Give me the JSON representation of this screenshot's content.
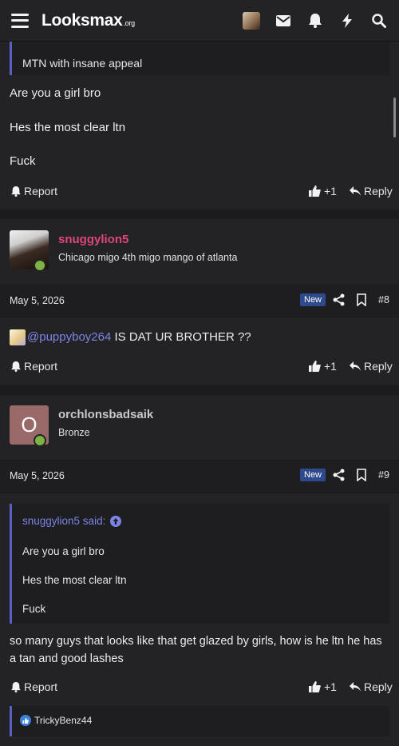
{
  "header": {
    "logo_main": "Looksmax",
    "logo_suffix": ".org"
  },
  "post1": {
    "quote_line": "MTN with insane appeal",
    "lines": [
      "Are you a girl bro",
      "Hes the most clear ltn",
      "Fuck"
    ],
    "report_label": "Report",
    "like_label": "+1",
    "reply_label": "Reply"
  },
  "post2": {
    "username": "snuggylion5",
    "user_title": "Chicago migo 4th migo mango of atlanta",
    "date": "May 5, 2026",
    "new_badge": "New",
    "post_number": "#8",
    "mention": "@puppyboy264",
    "text": " IS DAT UR BROTHER ??",
    "report_label": "Report",
    "like_label": "+1",
    "reply_label": "Reply",
    "username_color": "#e0457b"
  },
  "post3": {
    "avatar_letter": "O",
    "username": "orchlonsbadsaik",
    "user_title": "Bronze",
    "date": "May 5, 2026",
    "new_badge": "New",
    "post_number": "#9",
    "quote_author": "snuggylion5 said:",
    "quote_lines": [
      "Are you a girl bro",
      "Hes the most clear ltn",
      "Fuck"
    ],
    "body": "so many guys that looks like that get glazed by girls, how is he ltn he has a tan and good lashes",
    "report_label": "Report",
    "like_label": "+1",
    "reply_label": "Reply",
    "reaction_user": "TrickyBenz44",
    "avatar_color": "#9a6a6a",
    "username_color": "#c9c9c9"
  }
}
